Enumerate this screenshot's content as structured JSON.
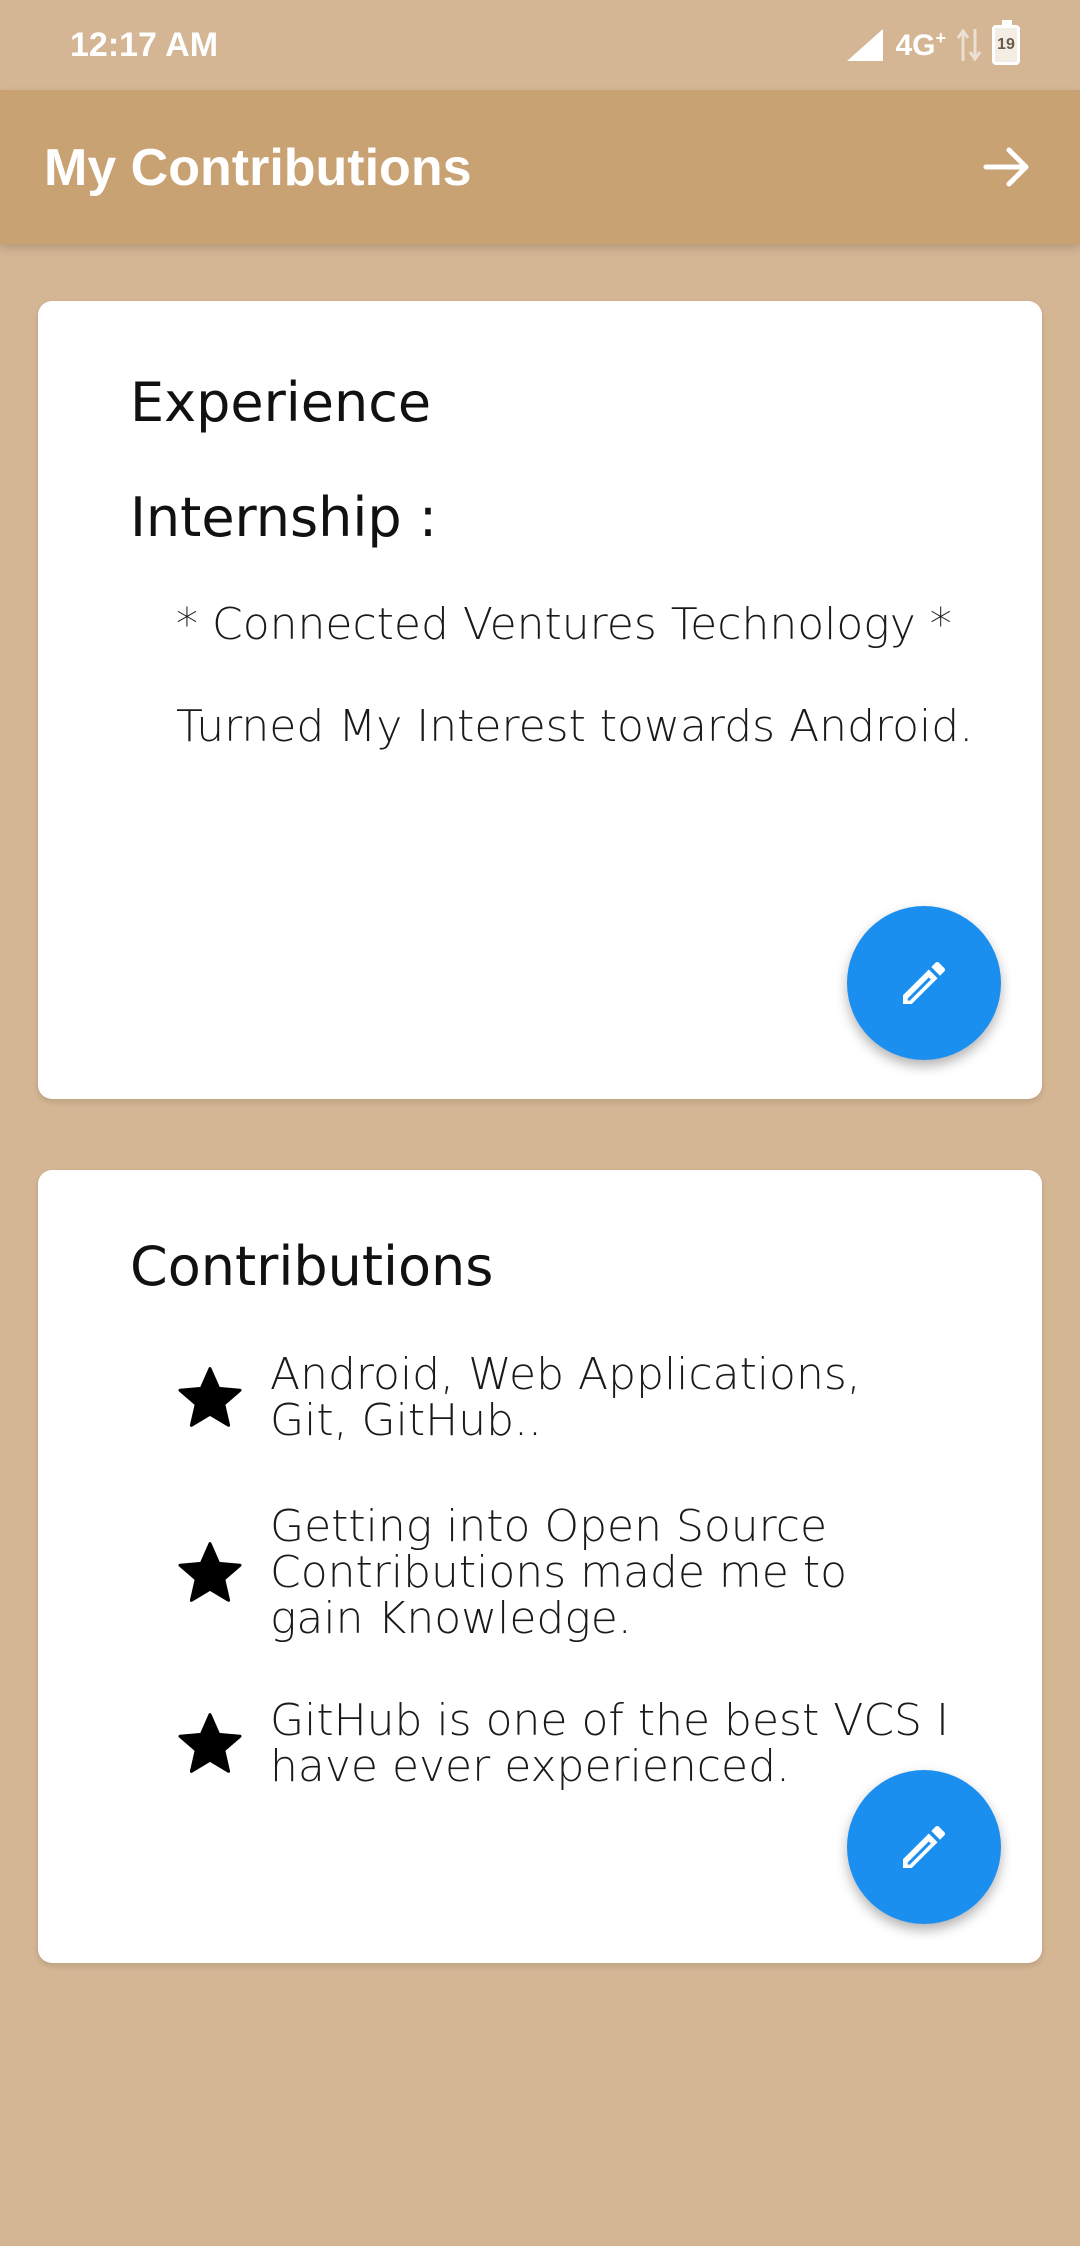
{
  "status_bar": {
    "time": "12:17 AM",
    "network": "4G",
    "network_plus": "+",
    "battery": "19"
  },
  "app_bar": {
    "title": "My Contributions",
    "forward_icon": "arrow-forward-icon"
  },
  "experience_card": {
    "heading": "Experience",
    "internship_label": "Internship :",
    "company": "* Connected Ventures Technology *",
    "description": "Turned My Interest towards Android.",
    "edit_icon": "pencil-icon"
  },
  "contributions_card": {
    "heading": "Contributions",
    "items": [
      {
        "icon": "star-icon",
        "text": "Android, Web Applications, Git, GitHub.."
      },
      {
        "icon": "star-icon",
        "text": "Getting into Open Source Contributions made me to gain Knowledge."
      },
      {
        "icon": "star-icon",
        "text": "GitHub is one of the best VCS I have ever experienced."
      }
    ],
    "edit_icon": "pencil-icon"
  },
  "colors": {
    "background": "#d4b594",
    "app_bar": "#c9a273",
    "fab": "#1a8ff0",
    "card": "#ffffff"
  }
}
